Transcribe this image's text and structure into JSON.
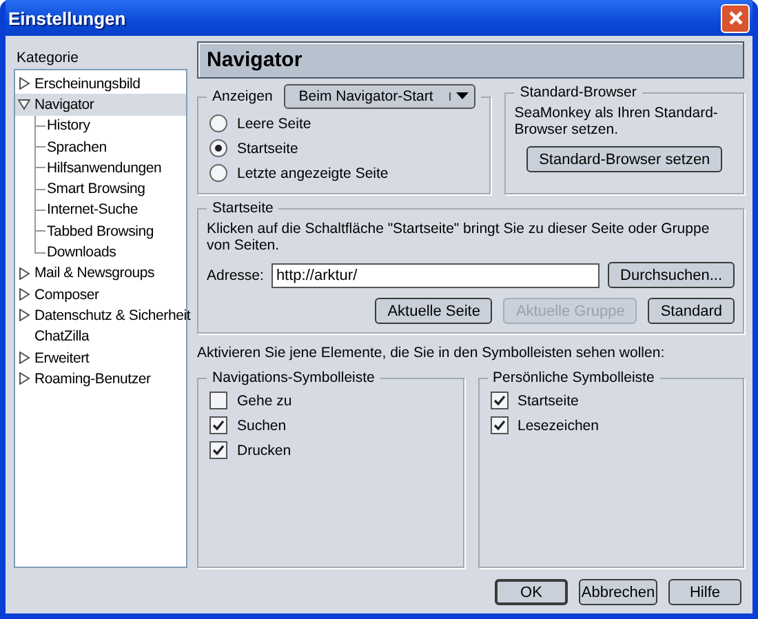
{
  "window": {
    "title": "Einstellungen"
  },
  "category": {
    "label": "Kategorie",
    "items": [
      {
        "label": "Erscheinungsbild",
        "kind": "folder",
        "selected": false
      },
      {
        "label": "Navigator",
        "kind": "folder",
        "expanded": true,
        "selected": true,
        "children": [
          {
            "label": "History",
            "selected": false
          },
          {
            "label": "Sprachen",
            "selected": false
          },
          {
            "label": "Hilfsanwendungen",
            "selected": false
          },
          {
            "label": "Smart Browsing",
            "selected": false
          },
          {
            "label": "Internet-Suche",
            "selected": false
          },
          {
            "label": "Tabbed Browsing",
            "selected": false
          },
          {
            "label": "Downloads",
            "selected": false
          }
        ]
      },
      {
        "label": "Mail & Newsgroups",
        "kind": "folder",
        "selected": false
      },
      {
        "label": "Composer",
        "kind": "folder",
        "selected": false
      },
      {
        "label": "Datenschutz & Sicherheit",
        "kind": "folder",
        "selected": false
      },
      {
        "label": "ChatZilla",
        "kind": "leaf",
        "selected": false
      },
      {
        "label": "Erweitert",
        "kind": "folder",
        "selected": false
      },
      {
        "label": "Roaming-Benutzer",
        "kind": "folder",
        "selected": false
      }
    ]
  },
  "panel": {
    "title": "Navigator",
    "display": {
      "label": "Anzeigen",
      "dropdown": "Beim Navigator-Start",
      "options": [
        {
          "label": "Leere Seite",
          "selected": false
        },
        {
          "label": "Startseite",
          "selected": true
        },
        {
          "label": "Letzte angezeigte Seite",
          "selected": false
        }
      ]
    },
    "default_browser": {
      "title": "Standard-Browser",
      "text": "SeaMonkey als Ihren Standard-Browser setzen.",
      "button": "Standard-Browser setzen"
    },
    "homepage": {
      "title": "Startseite",
      "text": "Klicken auf die Schaltfläche \"Startseite\" bringt Sie zu dieser Seite oder Gruppe von Seiten.",
      "address_label": "Adresse:",
      "address": "http://arktur/",
      "browse_button": "Durchsuchen...",
      "buttons": [
        {
          "label": "Aktuelle Seite",
          "disabled": false
        },
        {
          "label": "Aktuelle Gruppe",
          "disabled": true
        },
        {
          "label": "Standard",
          "disabled": false
        }
      ]
    },
    "toolbars_intro": "Aktivieren Sie jene Elemente, die Sie in den Symbolleisten sehen wollen:",
    "toolbars": [
      {
        "title": "Navigations-Symbolleiste",
        "items": [
          {
            "label": "Gehe zu",
            "checked": false
          },
          {
            "label": "Suchen",
            "checked": true
          },
          {
            "label": "Drucken",
            "checked": true
          }
        ]
      },
      {
        "title": "Persönliche Symbolleiste",
        "items": [
          {
            "label": "Startseite",
            "checked": true
          },
          {
            "label": "Lesezeichen",
            "checked": true
          }
        ]
      }
    ]
  },
  "buttons": [
    {
      "label": "OK",
      "default": true
    },
    {
      "label": "Abbrechen",
      "default": false
    },
    {
      "label": "Hilfe",
      "default": false
    }
  ]
}
